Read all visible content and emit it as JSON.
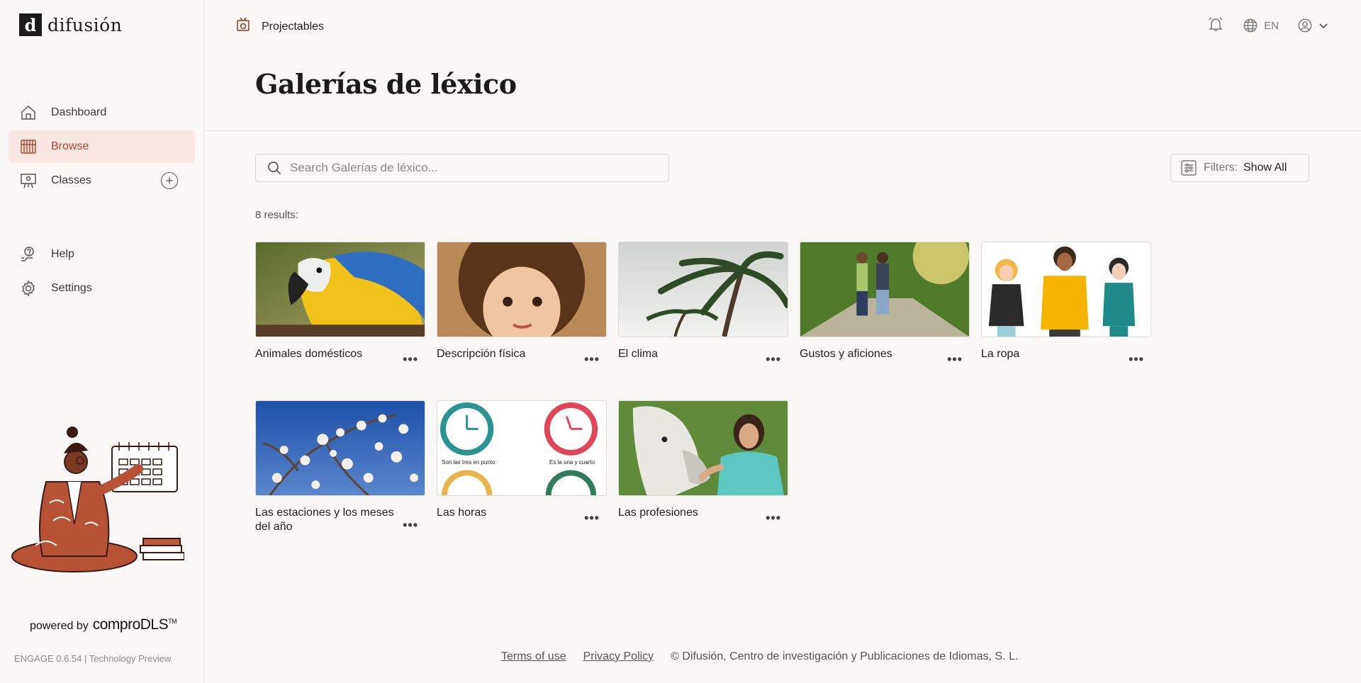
{
  "brand": {
    "logo_mark": "d",
    "logo_text": "difusión"
  },
  "sidebar": {
    "items": [
      {
        "label": "Dashboard",
        "icon": "home-icon"
      },
      {
        "label": "Browse",
        "icon": "library-icon",
        "active": true
      },
      {
        "label": "Classes",
        "icon": "classroom-icon"
      },
      {
        "label": "Help",
        "icon": "help-icon"
      },
      {
        "label": "Settings",
        "icon": "gear-icon"
      }
    ],
    "powered_by": "powered by",
    "powered_brand": "comproDLS",
    "trademark": "TM",
    "version": "ENGAGE 0.6.54 | Technology Preview"
  },
  "header": {
    "section": "Projectables",
    "language": "EN"
  },
  "page": {
    "title": "Galerías de léxico",
    "search_placeholder": "Search Galerías de léxico...",
    "filters_label": "Filters:",
    "filters_value": "Show All",
    "results": "8 results:"
  },
  "cards": [
    {
      "title": "Animales domésticos",
      "image": "parrot"
    },
    {
      "title": "Descripción física",
      "image": "child-portrait"
    },
    {
      "title": "El clima",
      "image": "palm-trees-wind"
    },
    {
      "title": "Gustos y aficiones",
      "image": "couple-rollerblading"
    },
    {
      "title": "La ropa",
      "image": "cartoon-people-clothes"
    },
    {
      "title": "Las estaciones y los meses del año",
      "image": "cherry-blossom"
    },
    {
      "title": "Las horas",
      "image": "clocks",
      "clock_captions": [
        "Son las tres en punto",
        "Es la una y cuarto"
      ]
    },
    {
      "title": "Las profesiones",
      "image": "vet-with-horse"
    }
  ],
  "footer": {
    "terms": "Terms of use",
    "privacy": "Privacy Policy",
    "copyright": "© Difusión, Centro de investigación y Publicaciones de Idiomas, S. L."
  },
  "colors": {
    "accent": "#b54a2b",
    "active_bg": "#f8e7e2",
    "background": "#f9f8f7"
  }
}
